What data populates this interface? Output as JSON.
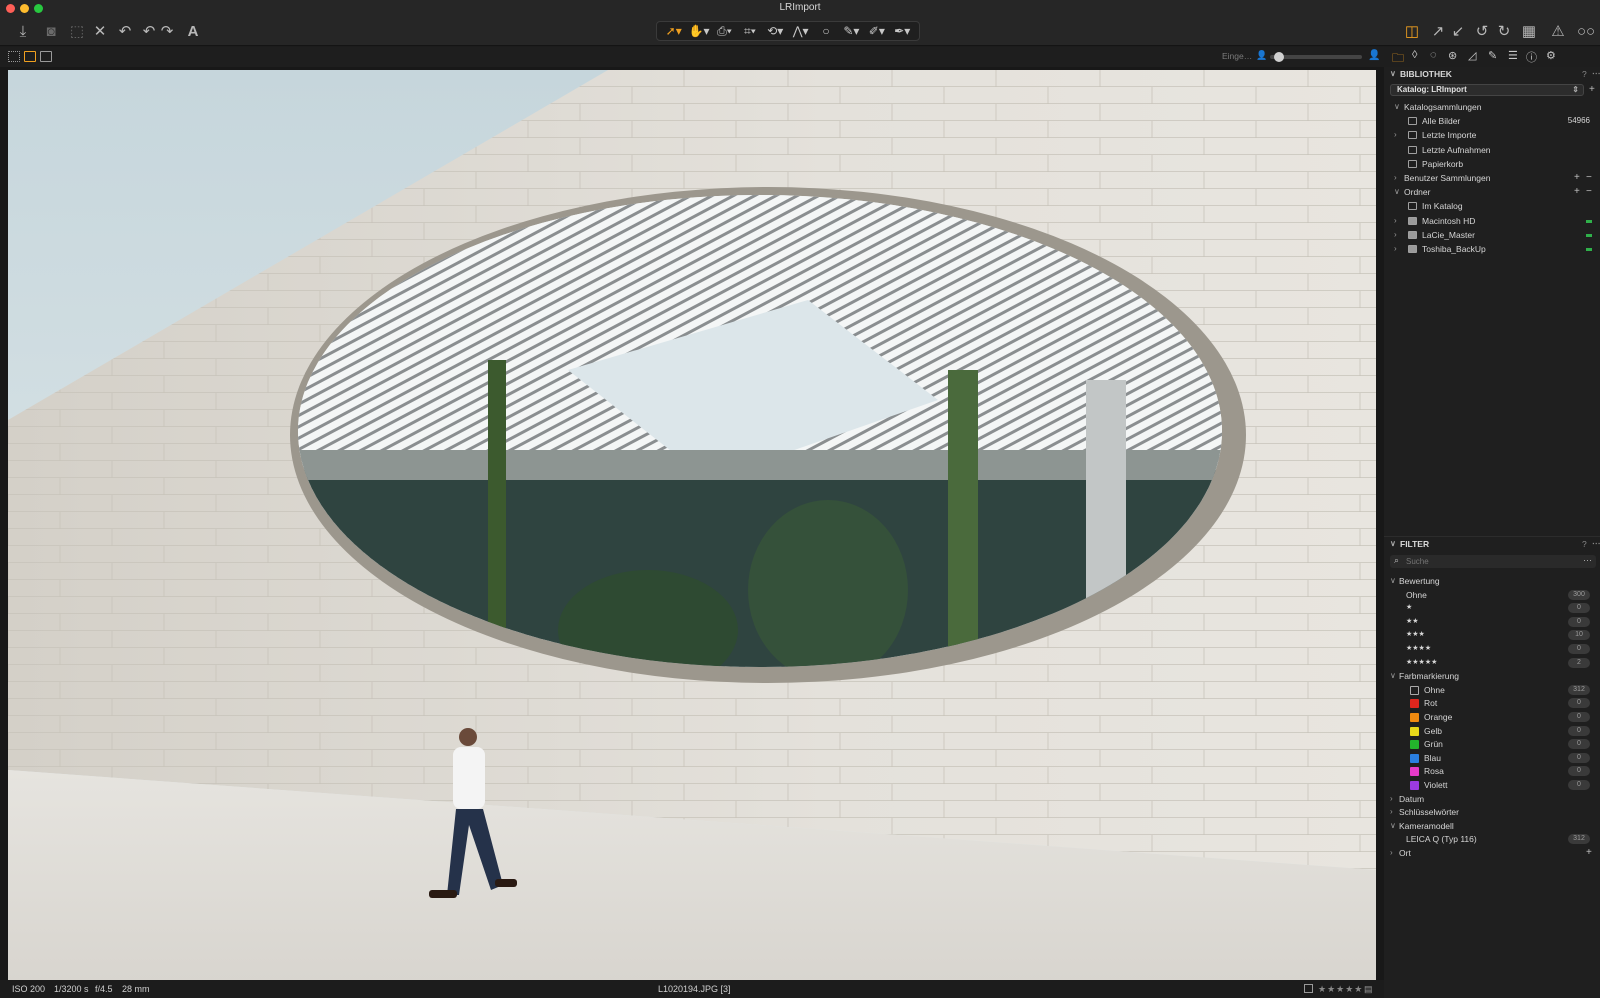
{
  "window": {
    "title": "LRImport",
    "controls": {
      "close_color": "#fe5f57",
      "minimize_color": "#febc2e",
      "zoom_color": "#28c840"
    }
  },
  "toolbar": {
    "left_icons": [
      "import-icon",
      "camera-icon",
      "export-icon",
      "delete-icon",
      "reset-icon",
      "undo-icon",
      "redo-icon",
      "text-icon"
    ],
    "tools": [
      {
        "name": "select-tool",
        "glyph": "➚▾"
      },
      {
        "name": "pan-tool",
        "glyph": "✋▾"
      },
      {
        "name": "stamp-tool",
        "glyph": "⎙▾"
      },
      {
        "name": "crop-tool",
        "glyph": "⌗▾"
      },
      {
        "name": "rotate-tool",
        "glyph": "⟲▾"
      },
      {
        "name": "keystone-tool",
        "glyph": "⋀▾"
      },
      {
        "name": "circle-tool",
        "glyph": "○"
      },
      {
        "name": "brush-tool",
        "glyph": "✎▾"
      },
      {
        "name": "eraser-tool",
        "glyph": "✐▾"
      },
      {
        "name": "picker-tool",
        "glyph": "✒▾"
      }
    ],
    "right_icons": [
      "layers-icon",
      "fullscreen-icon",
      "shrink-icon",
      "rotate-left-icon",
      "rotate-right-icon",
      "grid-icon",
      "warning-icon",
      "glasses-icon"
    ],
    "accent_color": "#f0a020"
  },
  "subbar": {
    "edit_label": "Einge…"
  },
  "statusbar": {
    "iso": "ISO 200",
    "shutter": "1/3200 s",
    "aperture": "f/4.5",
    "focal": "28 mm",
    "filename": "L1020194.JPG [3]",
    "stars": "★★★★★"
  },
  "library": {
    "title": "BIBLIOTHEK",
    "help": "?",
    "catalog_label": "Katalog: LRImport",
    "catalog_collections": {
      "label": "Katalogsammlungen",
      "items": [
        {
          "label": "Alle Bilder",
          "count": "54966",
          "icon": "images-icon"
        },
        {
          "label": "Letzte Importe",
          "count": "",
          "icon": "folder-icon"
        },
        {
          "label": "Letzte Aufnahmen",
          "count": "",
          "icon": "folder-icon"
        },
        {
          "label": "Papierkorb",
          "count": "",
          "icon": "trash-icon"
        }
      ]
    },
    "user_collections": {
      "label": "Benutzer Sammlungen"
    },
    "folders": {
      "label": "Ordner",
      "items": [
        {
          "label": "Im Katalog",
          "icon": "catalog-icon"
        },
        {
          "label": "Macintosh HD",
          "icon": "drive-icon"
        },
        {
          "label": "LaCie_Master",
          "icon": "drive-icon"
        },
        {
          "label": "Toshiba_BackUp",
          "icon": "drive-icon"
        }
      ]
    }
  },
  "filter": {
    "title": "FILTER",
    "help": "?",
    "search_placeholder": "Suche",
    "rating": {
      "label": "Bewertung",
      "items": [
        {
          "label": "Ohne",
          "count": "300"
        },
        {
          "label": "★",
          "count": "0"
        },
        {
          "label": "★★",
          "count": "0"
        },
        {
          "label": "★★★",
          "count": "10"
        },
        {
          "label": "★★★★",
          "count": "0"
        },
        {
          "label": "★★★★★",
          "count": "2"
        }
      ]
    },
    "color_label": {
      "label": "Farbmarkierung",
      "items": [
        {
          "label": "Ohne",
          "count": "312",
          "color": "none"
        },
        {
          "label": "Rot",
          "count": "0",
          "color": "#e0261d"
        },
        {
          "label": "Orange",
          "count": "0",
          "color": "#f08a10"
        },
        {
          "label": "Gelb",
          "count": "0",
          "color": "#e8d81a"
        },
        {
          "label": "Grün",
          "count": "0",
          "color": "#23b52c"
        },
        {
          "label": "Blau",
          "count": "0",
          "color": "#2a7fe0"
        },
        {
          "label": "Rosa",
          "count": "0",
          "color": "#e63ac8"
        },
        {
          "label": "Violett",
          "count": "0",
          "color": "#9b3ae0"
        }
      ]
    },
    "date": {
      "label": "Datum"
    },
    "keywords": {
      "label": "Schlüsselwörter"
    },
    "camera": {
      "label": "Kameramodell",
      "items": [
        {
          "label": "LEICA Q (Typ 116)",
          "count": "312"
        }
      ]
    },
    "location": {
      "label": "Ort"
    }
  }
}
